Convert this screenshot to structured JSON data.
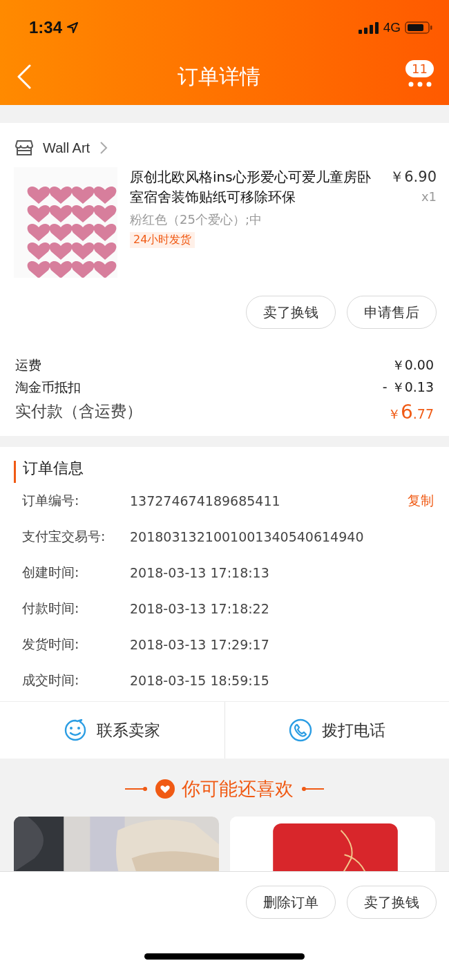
{
  "status_bar": {
    "time": "1:34",
    "network": "4G"
  },
  "nav": {
    "title": "订单详情",
    "badge": "11"
  },
  "store": {
    "name": "Wall Art"
  },
  "product": {
    "title": "原创北欧风格ins心形爱心可爱儿童房卧室宿舍装饰贴纸可移除环保",
    "price": "￥6.90",
    "quantity": "x1",
    "variant": "粉红色（25个爱心）;中",
    "tag": "24小时发货"
  },
  "item_buttons": [
    "卖了换钱",
    "申请售后"
  ],
  "fees": [
    {
      "label": "运费",
      "value": "￥0.00"
    },
    {
      "label": "淘金币抵扣",
      "value": "- ￥0.13"
    }
  ],
  "total": {
    "label": "实付款（含运费）",
    "currency": "￥",
    "integer": "6",
    "decimal": ".77"
  },
  "order_info": {
    "title": "订单信息",
    "rows": [
      {
        "label": "订单编号:",
        "value": "137274674189685411",
        "action": "复制"
      },
      {
        "label": "支付宝交易号:",
        "value": "2018031321001001340540614940"
      },
      {
        "label": "创建时间:",
        "value": "2018-03-13 17:18:13"
      },
      {
        "label": "付款时间:",
        "value": "2018-03-13 17:18:22"
      },
      {
        "label": "发货时间:",
        "value": "2018-03-13 17:29:17"
      },
      {
        "label": "成交时间:",
        "value": "2018-03-15 18:59:15"
      }
    ]
  },
  "contact": [
    {
      "kind": "chat",
      "label": "联系卖家"
    },
    {
      "kind": "phone",
      "label": "拨打电话"
    }
  ],
  "recommend": {
    "title": "你可能还喜欢"
  },
  "bottom_buttons": [
    "删除订单",
    "卖了换钱"
  ]
}
